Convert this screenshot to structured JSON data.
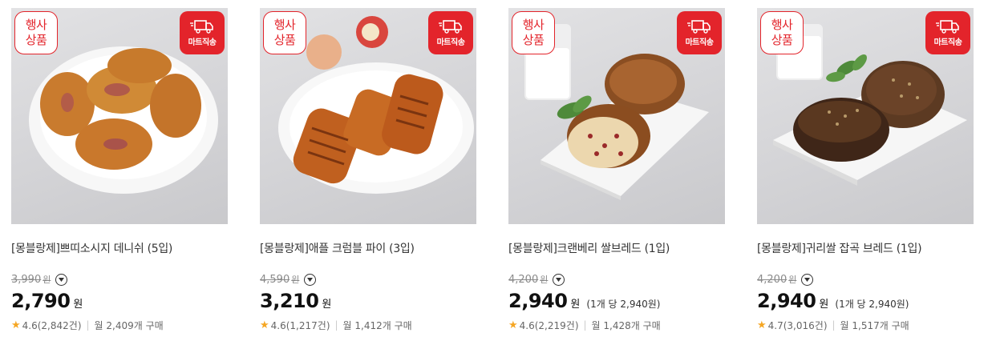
{
  "products": [
    {
      "badge_event": "행사\n상품",
      "badge_mart": "마트직송",
      "title": "[몽블랑제]쁘띠소시지 데니쉬 (5입)",
      "original_price": "3,990",
      "original_won": "원",
      "sale_price": "2,790",
      "sale_won": "원",
      "unit_price": "",
      "rating": "4.6(2,842건)",
      "monthly": "월 2,409개 구매"
    },
    {
      "badge_event": "행사\n상품",
      "badge_mart": "마트직송",
      "title": "[몽블랑제]애플 크럼블 파이 (3입)",
      "original_price": "4,590",
      "original_won": "원",
      "sale_price": "3,210",
      "sale_won": "원",
      "unit_price": "",
      "rating": "4.6(1,217건)",
      "monthly": "월 1,412개 구매"
    },
    {
      "badge_event": "행사\n상품",
      "badge_mart": "마트직송",
      "title": "[몽블랑제]크랜베리 쌀브레드 (1입)",
      "original_price": "4,200",
      "original_won": "원",
      "sale_price": "2,940",
      "sale_won": "원",
      "unit_price": "(1개 당 2,940원)",
      "rating": "4.6(2,219건)",
      "monthly": "월 1,428개 구매"
    },
    {
      "badge_event": "행사\n상품",
      "badge_mart": "마트직송",
      "title": "[몽블랑제]귀리쌀 잡곡 브레드 (1입)",
      "original_price": "4,200",
      "original_won": "원",
      "sale_price": "2,940",
      "sale_won": "원",
      "unit_price": "(1개 당 2,940원)",
      "rating": "4.7(3,016건)",
      "monthly": "월 1,517개 구매"
    }
  ],
  "colors": {
    "accent": "#e3242b",
    "star": "#f5a623"
  },
  "icons": {
    "delivery": "truck-icon",
    "rating": "star-icon",
    "expand": "chevron-down-icon"
  }
}
